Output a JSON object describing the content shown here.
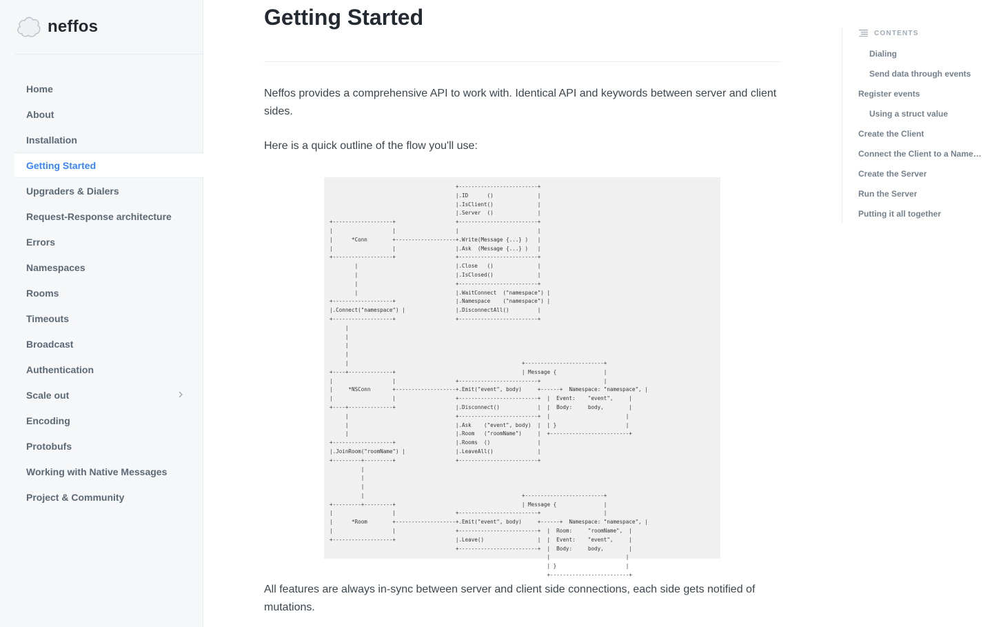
{
  "brand": {
    "name": "neffos",
    "logo_icon": "cloud-logo-icon"
  },
  "sidebar": {
    "items": [
      {
        "label": "Home",
        "active": false
      },
      {
        "label": "About",
        "active": false
      },
      {
        "label": "Installation",
        "active": false
      },
      {
        "label": "Getting Started",
        "active": true
      },
      {
        "label": "Upgraders & Dialers",
        "active": false
      },
      {
        "label": "Request-Response architecture",
        "active": false
      },
      {
        "label": "Errors",
        "active": false
      },
      {
        "label": "Namespaces",
        "active": false
      },
      {
        "label": "Rooms",
        "active": false
      },
      {
        "label": "Timeouts",
        "active": false
      },
      {
        "label": "Broadcast",
        "active": false
      },
      {
        "label": "Authentication",
        "active": false
      },
      {
        "label": "Scale out",
        "active": false,
        "expandable": true
      },
      {
        "label": "Encoding",
        "active": false
      },
      {
        "label": "Protobufs",
        "active": false
      },
      {
        "label": "Working with Native Messages",
        "active": false
      },
      {
        "label": "Project & Community",
        "active": false
      }
    ]
  },
  "main": {
    "title": "Getting Started",
    "intro": "Neffos provides a comprehensive API to work with. Identical API and keywords between server and client sides.",
    "outline": "Here is a quick outline of the flow you'll use:",
    "footer_text": "All features are always in-sync between server and client side connections, each side gets notified of mutations.",
    "diagram_text": "                                        +-------------------------+\n                                        |.ID      ()              |\n                                        |.IsClient()              |\n                                        |.Server  ()              |\n+-------------------+                   +-------------------------+\n|                   |                   |                         |\n|      *Conn        +-------------------+.Write(Message {...} )   |\n|                   |                   |.Ask  (Message {...} )   |\n+-------------------+                   +-------------------------+\n        |                               |.Close   ()              |\n        |                               |.IsClosed()              |\n        |                               +-------------------------+\n        |                               |.WaitConnect  (\"namespace\") |\n+-------------------+                   |.Namespace    (\"namespace\") |\n|.Connect(\"namespace\") |                |.DisconnectAll()         |\n+-------------------+                   +-------------------------+\n     |\n     |\n     |\n     |\n     |                                                       +-------------------------+\n+----+--------------+                                        | Message {               |\n|                   |                   +-------------------------+                    |\n|     *NSConn       +-------------------+.Emit(\"event\", body)     +------+  Namespace: \"namespace\", |\n|                   |                   +-------------------------+  |  Event:    \"event\",     |\n+----+--------------+                   |.Disconnect()            |  |  Body:     body,        |\n     |                                  +-------------------------+  |                        |\n     |                                  |.Ask    (\"event\", body)  |  | }                      |\n     |                                  |.Room   (\"roomName\")     |  +-------------------------+\n+-------------------+                   |.Rooms  ()               |\n|.JoinRoom(\"roomName\") |                |.LeaveAll()              |\n+---------+---------+                   +-------------------------+\n          |\n          |\n          |\n          |                                                  +-------------------------+\n+---------+---------+                                        | Message {               |\n|                   |                   +-------------------------+                    |\n|      *Room        +-------------------+.Emit(\"event\", body)     +------+  Namespace: \"namespace\", |\n|                   |                   +-------------------------+  |  Room:     \"roomName\",  |\n+-------------------+                   |.Leave()                 |  |  Event:    \"event\",     |\n                                        +-------------------------+  |  Body:     body,        |\n                                                                     |                        |\n                                                                     | }                      |\n                                                                     +-------------------------+"
  },
  "toc": {
    "header": "CONTENTS",
    "items": [
      {
        "label": "Dialing",
        "level": 2
      },
      {
        "label": "Send data through events",
        "level": 2
      },
      {
        "label": "Register events",
        "level": 1
      },
      {
        "label": "Using a struct value",
        "level": 2
      },
      {
        "label": "Create the Client",
        "level": 1
      },
      {
        "label": "Connect the Client to a Namespace",
        "level": 1
      },
      {
        "label": "Create the Server",
        "level": 1
      },
      {
        "label": "Run the Server",
        "level": 1
      },
      {
        "label": "Putting it all together",
        "level": 1
      }
    ]
  },
  "colors": {
    "accent": "#3884ff",
    "sidebar_bg": "#f5f7f9",
    "text": "#3b454e",
    "muted": "#74818d",
    "diagram_bg": "#f0f0f0"
  }
}
